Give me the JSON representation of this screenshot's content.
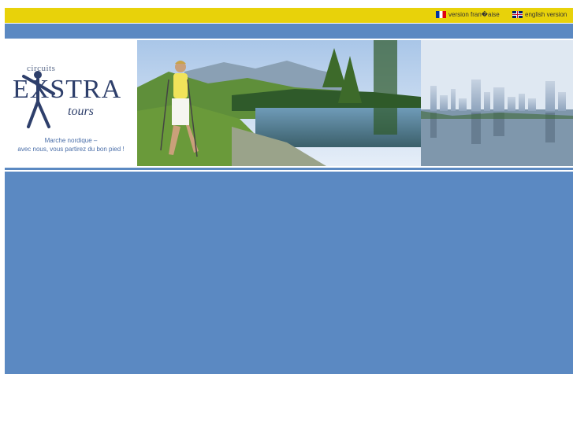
{
  "topbar": {
    "lang_fr": {
      "label": "version fran�aise",
      "flag": "flag-france-icon"
    },
    "lang_en": {
      "label": "english version",
      "flag": "flag-uk-icon"
    }
  },
  "logo": {
    "small": "circuits",
    "main": "EXSTRA",
    "sub": "tours"
  },
  "tagline": {
    "line1": "Marche nordique –",
    "line2": "avec nous, vous partirez du bon pied !"
  },
  "colors": {
    "topbar": "#e8d20a",
    "blue": "#5b89c2",
    "logo": "#2e3f6b",
    "tagline": "#4a6ea8"
  }
}
